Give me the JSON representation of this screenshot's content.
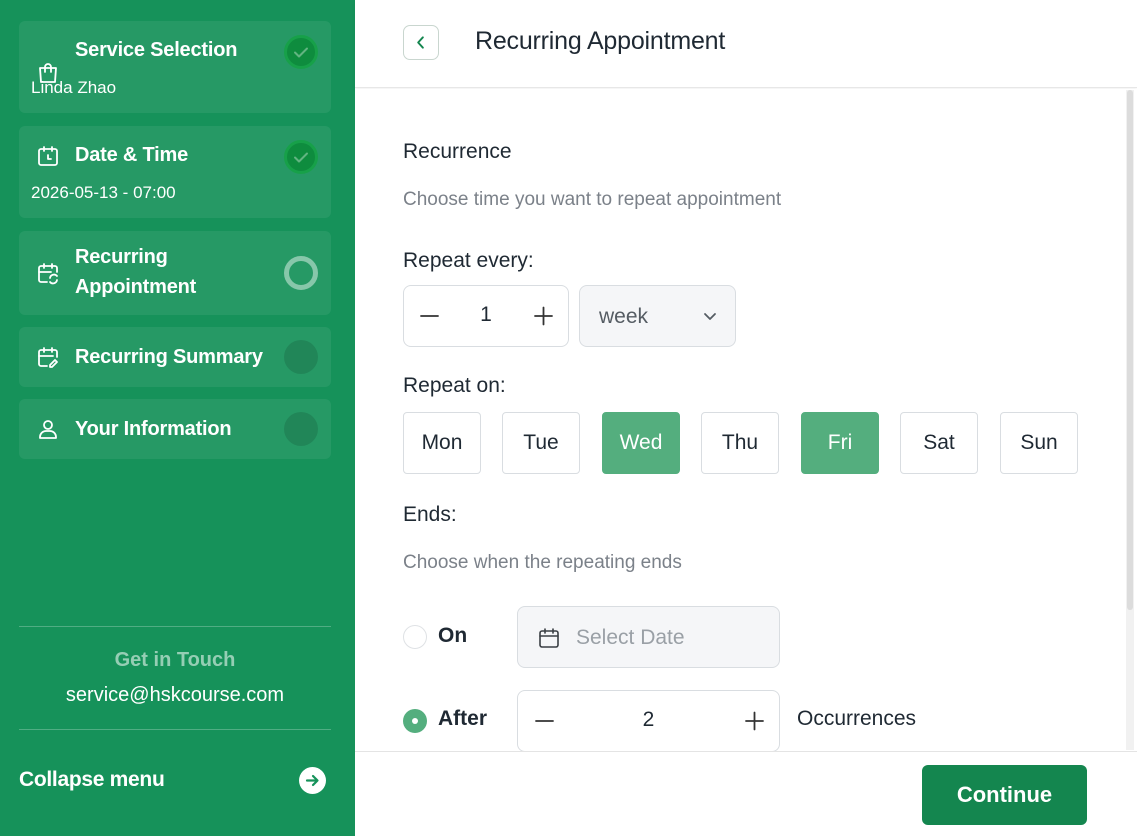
{
  "sidebar": {
    "steps": [
      {
        "title": "Service Selection",
        "subtitle": "Linda Zhao",
        "icon": "shopping-bag-icon",
        "status": "completed"
      },
      {
        "title": "Date & Time",
        "subtitle": "2026-05-13 - 07:00",
        "icon": "calendar-clock-icon",
        "status": "completed"
      },
      {
        "title_line1": "Recurring",
        "title_line2": "Appointment",
        "icon": "calendar-repeat-icon",
        "status": "current"
      },
      {
        "title": "Recurring Summary",
        "icon": "calendar-edit-icon",
        "status": "pending"
      },
      {
        "title": "Your Information",
        "icon": "user-icon",
        "status": "pending"
      }
    ],
    "contact_title": "Get in Touch",
    "contact_email": "service@hskcourse.com",
    "collapse_label": "Collapse menu"
  },
  "header": {
    "title": "Recurring Appointment"
  },
  "form": {
    "recurrence_label": "Recurrence",
    "recurrence_hint": "Choose time you want to repeat appointment",
    "repeat_every_label": "Repeat every:",
    "repeat_every_value": "1",
    "repeat_unit": "week",
    "repeat_on_label": "Repeat on:",
    "days": [
      {
        "label": "Mon",
        "selected": false
      },
      {
        "label": "Tue",
        "selected": false
      },
      {
        "label": "Wed",
        "selected": true
      },
      {
        "label": "Thu",
        "selected": false
      },
      {
        "label": "Fri",
        "selected": true
      },
      {
        "label": "Sat",
        "selected": false
      },
      {
        "label": "Sun",
        "selected": false
      }
    ],
    "ends_label": "Ends:",
    "ends_hint": "Choose when the repeating ends",
    "ends_on_label": "On",
    "ends_on_placeholder": "Select Date",
    "ends_after_label": "After",
    "occurrences_value": "2",
    "occurrences_label": "Occurrences",
    "selected_end_option": "After"
  },
  "footer": {
    "continue_label": "Continue"
  },
  "colors": {
    "sidebar_bg": "#16925a",
    "accent": "#54ae7e",
    "primary_button": "#14864f"
  }
}
